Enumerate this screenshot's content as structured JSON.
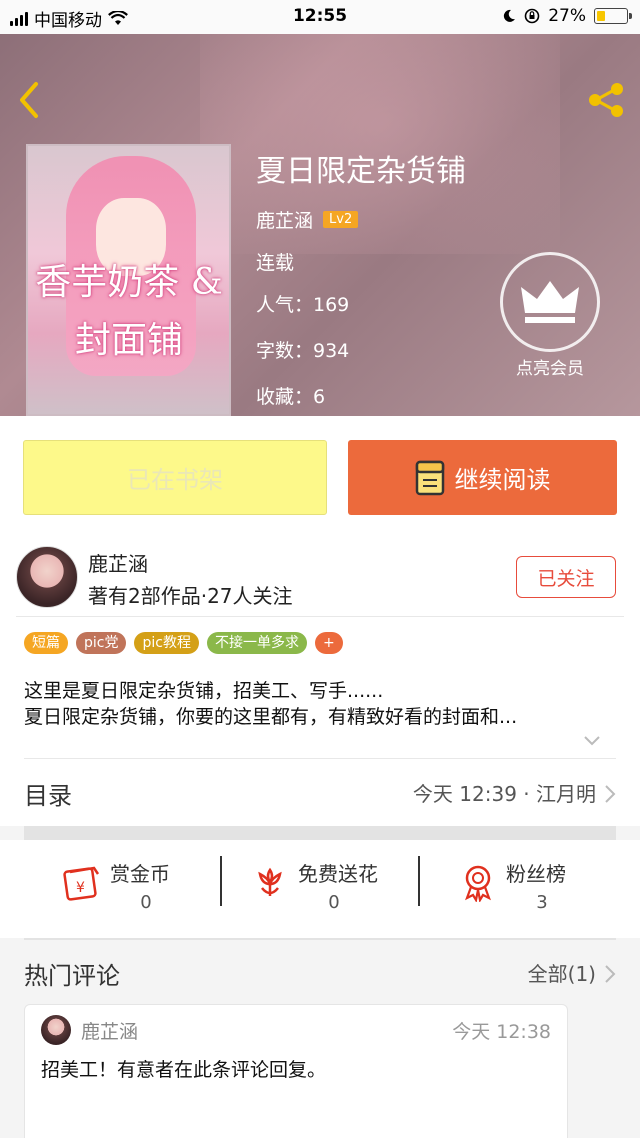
{
  "status_bar": {
    "carrier": "中国移动",
    "time": "12:55",
    "battery": "27%",
    "battery_level": 0.27
  },
  "book": {
    "title": "夏日限定杂货铺",
    "cover_text": "香芋奶茶 & 封面铺",
    "author": "鹿芷涵",
    "level": "Lv2",
    "status": "连载",
    "popularity": "人气：169",
    "word_count": "字数：934",
    "favorites": "收藏：6",
    "vip_label": "点亮会员"
  },
  "actions": {
    "shelf_label": "已在书架",
    "read_label": "继续阅读"
  },
  "author_card": {
    "name": "鹿芷涵",
    "stats": "著有2部作品·27人关注",
    "follow_label": "已关注",
    "tags": [
      {
        "label": "短篇",
        "color": "#f5a623"
      },
      {
        "label": "pic党",
        "color": "#c0745a"
      },
      {
        "label": "pic教程",
        "color": "#d4a017"
      },
      {
        "label": "不接一单多求",
        "color": "#8bb84a"
      },
      {
        "label": "+",
        "color": "#ec6a3c"
      }
    ],
    "intro_line1": "这里是夏日限定杂货铺，招美工、写手......",
    "intro_line2": "夏日限定杂货铺，你要的这里都有，有精致好看的封面和..."
  },
  "catalog": {
    "title": "目录",
    "update": "今天 12:39 · 江月明"
  },
  "stats": [
    {
      "label": "赏金币",
      "count": "0",
      "icon": "coin-envelope-icon"
    },
    {
      "label": "免费送花",
      "count": "0",
      "icon": "flower-icon"
    },
    {
      "label": "粉丝榜",
      "count": "3",
      "icon": "medal-icon"
    }
  ],
  "comments": {
    "title": "热门评论",
    "all_label": "全部(1)",
    "items": [
      {
        "user": "鹿芷涵",
        "time": "今天 12:38",
        "text": "招美工！有意者在此条评论回复。"
      }
    ]
  },
  "colors": {
    "accent": "#ec6a3c",
    "shelf_bg": "#fdf98a",
    "follow": "#e74c3c",
    "badge": "#f5a623"
  }
}
